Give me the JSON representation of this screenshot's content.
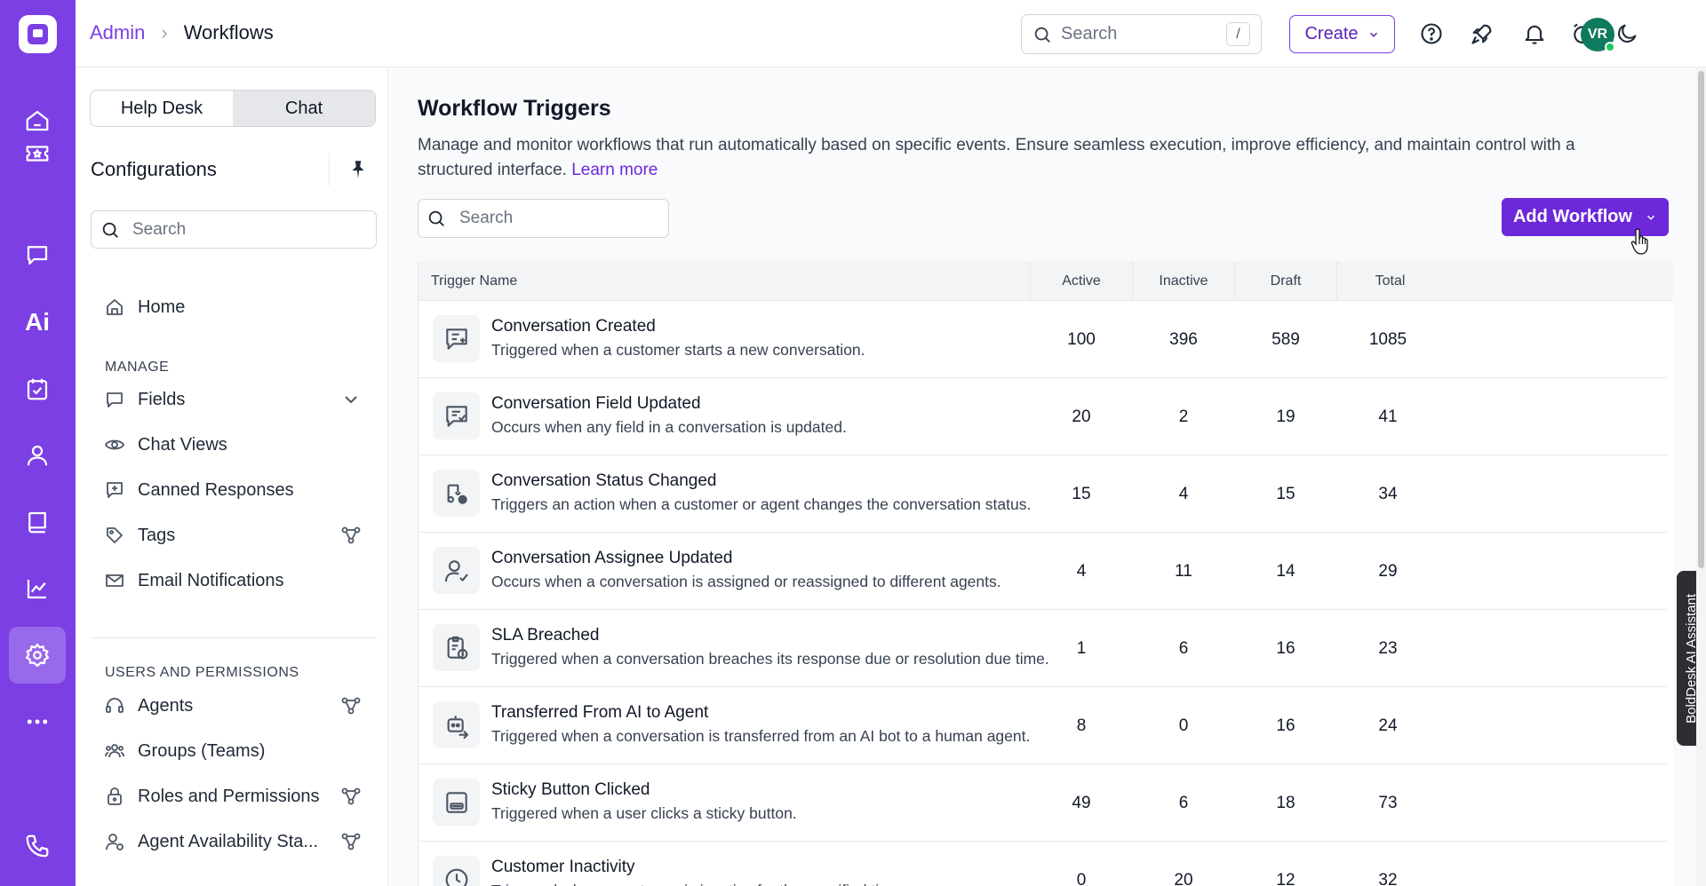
{
  "header": {
    "breadcrumb": {
      "root": "Admin",
      "current": "Workflows"
    },
    "search_placeholder": "Search",
    "search_shortcut": "/",
    "create_label": "Create",
    "avatar_initials": "VR"
  },
  "rail": {
    "items": [
      "home-icon",
      "ticket-icon",
      "chat-icon",
      "ai-icon",
      "tasks-icon",
      "contacts-icon",
      "knowledge-base-icon",
      "reports-icon",
      "settings-icon",
      "more-icon",
      "phone-icon"
    ],
    "ai_label": "Ai",
    "active": "settings-icon",
    "brand_color": "#7b3fe4"
  },
  "sidebar": {
    "tabs": [
      {
        "label": "Help Desk",
        "selected": false
      },
      {
        "label": "Chat",
        "selected": true
      }
    ],
    "title": "Configurations",
    "search_placeholder": "Search",
    "home_label": "Home",
    "sections": [
      {
        "label": "MANAGE",
        "items": [
          {
            "label": "Fields",
            "icon": "chat-bubble-icon",
            "tail": "chevron-down-icon"
          },
          {
            "label": "Chat Views",
            "icon": "eye-icon"
          },
          {
            "label": "Canned Responses",
            "icon": "canned-response-icon"
          },
          {
            "label": "Tags",
            "icon": "tag-icon",
            "tail": "workflow-icon"
          },
          {
            "label": "Email Notifications",
            "icon": "email-notification-icon"
          }
        ]
      },
      {
        "label": "USERS AND PERMISSIONS",
        "items": [
          {
            "label": "Agents",
            "icon": "headset-icon",
            "tail": "workflow-icon"
          },
          {
            "label": "Groups (Teams)",
            "icon": "group-icon"
          },
          {
            "label": "Roles and Permissions",
            "icon": "lock-icon",
            "tail": "workflow-icon"
          },
          {
            "label": "Agent Availability Sta...",
            "icon": "user-status-icon",
            "tail": "workflow-icon"
          }
        ]
      }
    ]
  },
  "main": {
    "title": "Workflow Triggers",
    "description": "Manage and monitor workflows that run automatically based on specific events. Ensure seamless execution, improve efficiency, and maintain control with a structured interface.",
    "learn_more": "Learn more",
    "search_placeholder": "Search",
    "add_button": "Add Workflow",
    "columns": [
      "Trigger Name",
      "Active",
      "Inactive",
      "Draft",
      "Total"
    ],
    "rows": [
      {
        "name": "Conversation Created",
        "description": "Triggered when a customer starts a new conversation.",
        "icon": "conversation-add-icon",
        "active": "100",
        "inactive": "396",
        "draft": "589",
        "total": "1085"
      },
      {
        "name": "Conversation Field Updated",
        "description": "Occurs when any field in a conversation is updated.",
        "icon": "conversation-check-icon",
        "active": "20",
        "inactive": "2",
        "draft": "19",
        "total": "41"
      },
      {
        "name": "Conversation Status Changed",
        "description": "Triggers an action when a customer or agent changes the conversation status.",
        "icon": "status-change-icon",
        "active": "15",
        "inactive": "4",
        "draft": "15",
        "total": "34"
      },
      {
        "name": "Conversation Assignee Updated",
        "description": "Occurs when a conversation is assigned or reassigned to different agents.",
        "icon": "user-check-icon",
        "active": "4",
        "inactive": "11",
        "draft": "14",
        "total": "29"
      },
      {
        "name": "SLA Breached",
        "description": "Triggered when a conversation breaches its response due or resolution due time.",
        "icon": "clipboard-clock-icon",
        "active": "1",
        "inactive": "6",
        "draft": "16",
        "total": "23"
      },
      {
        "name": "Transferred From AI to Agent",
        "description": "Triggered when a conversation is transferred from an AI bot to a human agent.",
        "icon": "bot-transfer-icon",
        "active": "8",
        "inactive": "0",
        "draft": "16",
        "total": "24"
      },
      {
        "name": "Sticky Button Clicked",
        "description": "Triggered when a user clicks a sticky button.",
        "icon": "sticky-button-icon",
        "active": "49",
        "inactive": "6",
        "draft": "18",
        "total": "73"
      },
      {
        "name": "Customer Inactivity",
        "description": "Triggered when a customer is inactive for the specified time.",
        "icon": "clock-icon",
        "active": "0",
        "inactive": "20",
        "draft": "12",
        "total": "32"
      }
    ]
  },
  "assistant_tab": "BoldDesk AI Assistant"
}
